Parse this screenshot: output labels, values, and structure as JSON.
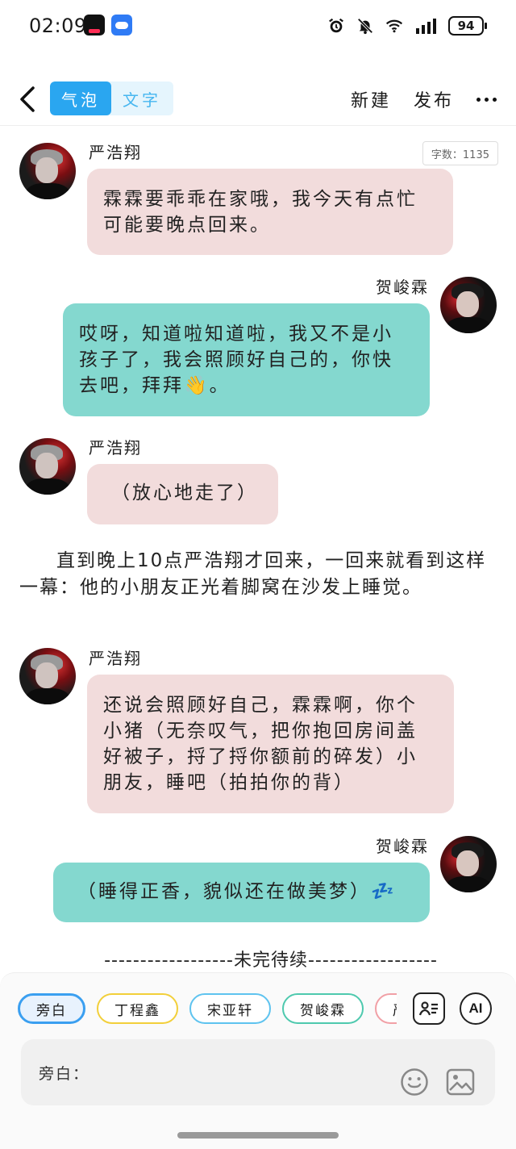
{
  "status_bar": {
    "time": "02:09",
    "battery": "94",
    "icons": [
      "tiktok-app-icon",
      "cloud-app-icon",
      "alarm-icon",
      "mute-icon",
      "wifi-icon",
      "signal-icon",
      "battery-icon"
    ]
  },
  "header": {
    "mode_tabs": [
      "气泡",
      "文字"
    ],
    "active_tab": "气泡",
    "new_label": "新建",
    "publish_label": "发布"
  },
  "content": {
    "word_count": "字数：1135",
    "messages": [
      {
        "speaker": "严浩翔",
        "text": "霖霖要乖乖在家哦，我今天有点忙可能要晚点回来。",
        "side": "left",
        "color": "pink"
      },
      {
        "speaker": "贺峻霖",
        "text": "哎呀，知道啦知道啦，我又不是小孩子了，我会照顾好自己的，你快去吧，拜拜👋。",
        "side": "right",
        "color": "teal"
      },
      {
        "speaker": "严浩翔",
        "text": "（放心地走了）",
        "side": "left",
        "color": "pink"
      }
    ],
    "narration": "直到晚上10点严浩翔才回来，一回来就看到这样一幕：他的小朋友正光着脚窝在沙发上睡觉。",
    "messages2": [
      {
        "speaker": "严浩翔",
        "text": "还说会照顾好自己，霖霖啊，你个小猪（无奈叹气，把你抱回房间盖好被子，捋了捋你额前的碎发）小朋友，睡吧（拍拍你的背）",
        "side": "left",
        "color": "pink"
      },
      {
        "speaker": "贺峻霖",
        "text": "（睡得正香，貌似还在做美梦）💤",
        "side": "right",
        "color": "teal"
      }
    ],
    "to_be_continued": "------------------未完待续------------------"
  },
  "bottom": {
    "chips": [
      "旁白",
      "丁程鑫",
      "宋亚轩",
      "贺峻霖",
      "严浩翔"
    ],
    "selected_chip": "旁白",
    "ai_label": "AI",
    "input_label": "旁白："
  },
  "colors": {
    "accent": "#2aa6f0",
    "bubble_pink": "#f2dcdc",
    "bubble_teal": "#84d8cf"
  }
}
